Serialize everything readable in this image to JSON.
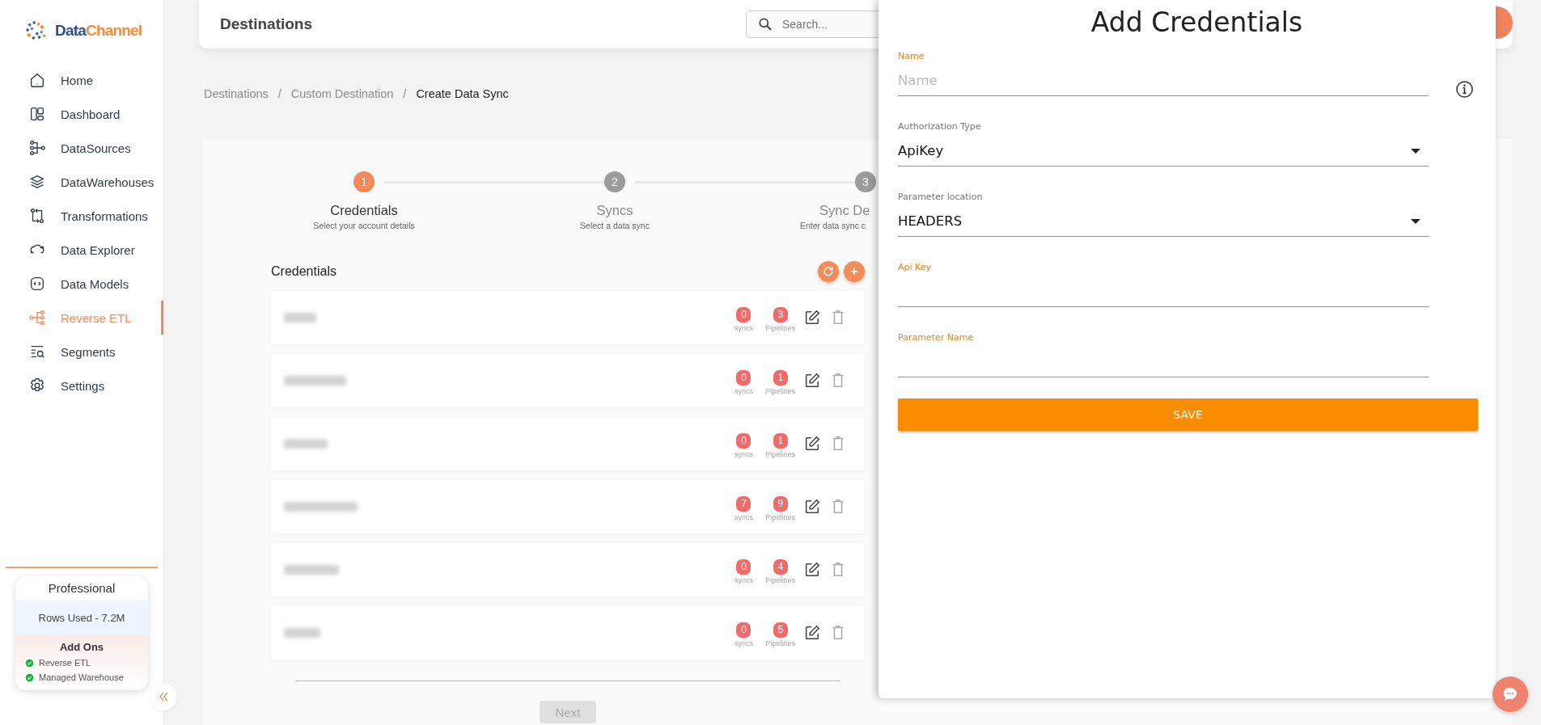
{
  "sidebar": {
    "logo": {
      "first": "Data",
      "second": "Channel"
    },
    "items": [
      {
        "label": "Home",
        "selected": false
      },
      {
        "label": "Dashboard",
        "selected": false
      },
      {
        "label": "DataSources",
        "selected": false
      },
      {
        "label": "DataWarehouses",
        "selected": false
      },
      {
        "label": "Transformations",
        "selected": false
      },
      {
        "label": "Data Explorer",
        "selected": false
      },
      {
        "label": "Data Models",
        "selected": false
      },
      {
        "label": "Reverse ETL",
        "selected": true
      },
      {
        "label": "Segments",
        "selected": false
      },
      {
        "label": "Settings",
        "selected": false
      }
    ],
    "plan": {
      "title": "Professional",
      "usage": "Rows Used - 7.2M",
      "addons_title": "Add Ons",
      "addons": [
        {
          "label": "Reverse ETL",
          "enabled": true
        },
        {
          "label": "Managed Warehouse",
          "enabled": true
        }
      ]
    }
  },
  "header": {
    "title": "Destinations",
    "search": {
      "placeholder": "Search..."
    }
  },
  "breadcrumb": [
    {
      "label": "Destinations",
      "current": false
    },
    {
      "label": "Custom Destination",
      "current": false
    },
    {
      "label": "Create Data Sync",
      "current": true
    }
  ],
  "separator": "/",
  "stepper": [
    {
      "number": "1",
      "title": "Credentials",
      "subtitle": "Select your account details",
      "selected": true
    },
    {
      "number": "2",
      "title": "Syncs",
      "subtitle": "Select a data sync",
      "selected": false
    },
    {
      "number": "3",
      "title": "Sync De",
      "subtitle": "Enter data sync c",
      "selected": false
    }
  ],
  "credentials": {
    "title": "Credentials",
    "add_label": "+",
    "rows": [
      {
        "syncs": "0",
        "syncs_label": "syncs",
        "pipelines": "3",
        "pipelines_label": "Pipelines"
      },
      {
        "syncs": "0",
        "syncs_label": "syncs",
        "pipelines": "1",
        "pipelines_label": "Pipelines"
      },
      {
        "syncs": "0",
        "syncs_label": "syncs",
        "pipelines": "1",
        "pipelines_label": "Pipelines"
      },
      {
        "syncs": "7",
        "syncs_label": "syncs",
        "pipelines": "9",
        "pipelines_label": "Pipelines"
      },
      {
        "syncs": "0",
        "syncs_label": "syncs",
        "pipelines": "4",
        "pipelines_label": "Pipelines"
      },
      {
        "syncs": "0",
        "syncs_label": "syncs",
        "pipelines": "5",
        "pipelines_label": "Pipelines"
      }
    ]
  },
  "next_button": {
    "label": "Next",
    "disabled": true
  },
  "drawer": {
    "title": "Add Credentials",
    "fields": [
      {
        "kind": "text",
        "label": "Name",
        "placeholder": "Name",
        "info": true
      },
      {
        "kind": "select",
        "label": "Authorization Type",
        "value": "ApiKey"
      },
      {
        "kind": "select",
        "label": "Parameter location",
        "value": "HEADERS"
      },
      {
        "kind": "text",
        "label": "Api Key"
      },
      {
        "kind": "text",
        "label": "Parameter Name"
      }
    ],
    "save": "SAVE"
  }
}
